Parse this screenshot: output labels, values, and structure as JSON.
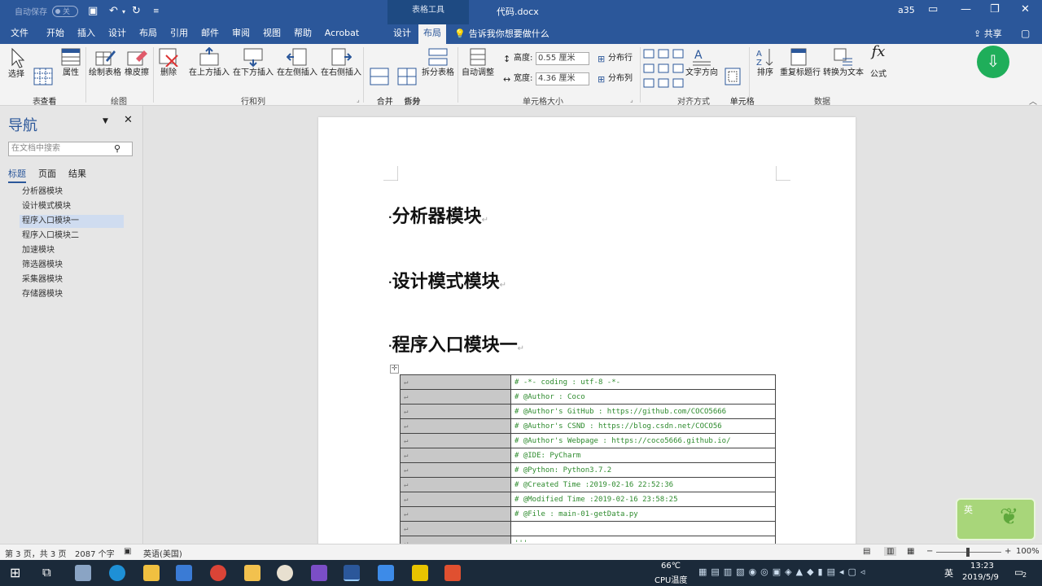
{
  "titlebar": {
    "autosave_label": "自动保存",
    "autosave_state": "关",
    "context_tool": "表格工具",
    "doc_title": "代码.docx",
    "user": "a35"
  },
  "menu": {
    "tabs": [
      "文件",
      "开始",
      "插入",
      "设计",
      "布局",
      "引用",
      "邮件",
      "审阅",
      "视图",
      "帮助",
      "Acrobat",
      "设计",
      "布局"
    ],
    "active_index": 12,
    "tellme": "告诉我你想要做什么",
    "share": "共享"
  },
  "ribbon": {
    "buttons": {
      "select": "选择",
      "gridlines": "查看\n网格线",
      "properties": "属性",
      "draw_table": "绘制表格",
      "eraser": "橡皮擦",
      "delete": "删除",
      "insert_above": "在上方插入",
      "insert_below": "在下方插入",
      "insert_left": "在左侧插入",
      "insert_right": "在右侧插入",
      "merge_cells": "合并\n单元格",
      "split_cells": "拆分\n单元格",
      "split_table": "拆分表格",
      "autofit": "自动调整",
      "distribute_rows": "分布行",
      "distribute_cols": "分布列",
      "text_direction": "文字方向",
      "cell_margins": "单元格\n边距",
      "sort": "排序",
      "repeat_header": "重复标题行",
      "convert_text": "转换为文本",
      "formula": "公式"
    },
    "height_label": "高度:",
    "height_value": "0.55 厘米",
    "width_label": "宽度:",
    "width_value": "4.36 厘米",
    "groups": [
      "表",
      "绘图",
      "行和列",
      "合并",
      "单元格大小",
      "对齐方式",
      "数据"
    ]
  },
  "nav": {
    "title": "导航",
    "search_placeholder": "在文档中搜索",
    "tabs": [
      "标题",
      "页面",
      "结果"
    ],
    "items": [
      "分析器模块",
      "设计模式模块",
      "程序入口模块一",
      "程序入口模块二",
      "加速模块",
      "筛选器模块",
      "采集器模块",
      "存储器模块"
    ],
    "selected_index": 2
  },
  "document": {
    "headings": [
      "分析器模块",
      "设计模式模块",
      "程序入口模块一"
    ],
    "code_lines": [
      "# -*- coding : utf-8 -*-",
      "# @Author : Coco",
      "# @Author's GitHub : https://github.com/COCO5666",
      "# @Author's CSND : https://blog.csdn.net/COCO56",
      "# @Author's Webpage : https://coco5666.github.io/",
      "# @IDE: PyCharm",
      "# @Python: Python3.7.2",
      "# @Created Time :2019-02-16 22:52:36",
      "# @Modified Time :2019-02-16 23:58:25",
      "# @File : main-01-getData.py",
      "",
      "'''"
    ]
  },
  "status": {
    "page": "第 3 页，共 3 页",
    "words": "2087 个字",
    "lang": "英语(美国)",
    "zoom": "100%"
  },
  "taskbar": {
    "temp": "66℃",
    "temp_label": "CPU温度",
    "ime": "英",
    "time": "13:23",
    "date": "2019/5/9",
    "notif": "2"
  },
  "ime_widget": "英",
  "colors": {
    "brand": "#2b579a",
    "code": "#2e8b2e",
    "cloud": "#1fae5a"
  }
}
